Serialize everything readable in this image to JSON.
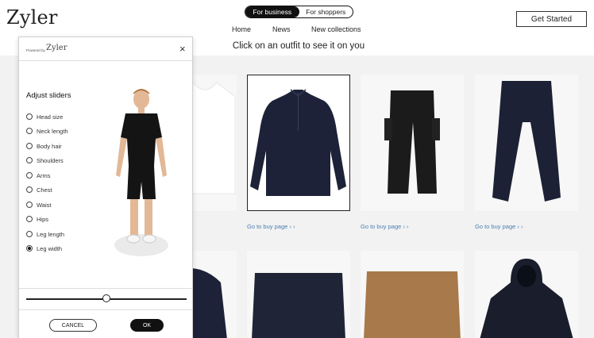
{
  "brand": {
    "logo": "Zyler"
  },
  "header": {
    "toggle": [
      {
        "label": "For business",
        "active": true
      },
      {
        "label": "For shoppers",
        "active": false
      }
    ],
    "get_started_label": "Get Started",
    "nav": [
      "Home",
      "News",
      "New collections"
    ],
    "instruction": "Click on an outfit to see it on you"
  },
  "products": {
    "buy_link": "Go to buy page › ›",
    "items": [
      {
        "name": "white-tshirt",
        "color": "#f4f4f4"
      },
      {
        "name": "navy-quarter-zip-sweater",
        "color": "#1d2238",
        "selected": true
      },
      {
        "name": "black-cargo-pants",
        "color": "#1b1b1b"
      },
      {
        "name": "navy-joggers",
        "color": "#1c2135"
      },
      {
        "name": "navy-jacket",
        "color": "#1d2238"
      },
      {
        "name": "navy-shorts",
        "color": "#1f2536"
      },
      {
        "name": "tan-shorts",
        "color": "#a8794a"
      },
      {
        "name": "navy-hoodie",
        "color": "#1a1d2c"
      }
    ]
  },
  "modal": {
    "powered_by": "Powered by",
    "logo": "Zyler",
    "title": "Adjust sliders",
    "options": [
      {
        "label": "Head size",
        "checked": false
      },
      {
        "label": "Neck length",
        "checked": false
      },
      {
        "label": "Body hair",
        "checked": false
      },
      {
        "label": "Shoulders",
        "checked": false
      },
      {
        "label": "Arms",
        "checked": false
      },
      {
        "label": "Chest",
        "checked": false
      },
      {
        "label": "Waist",
        "checked": false
      },
      {
        "label": "Hips",
        "checked": false
      },
      {
        "label": "Leg length",
        "checked": false
      },
      {
        "label": "Leg width",
        "checked": true
      }
    ],
    "slider_value": 0.5,
    "cancel_label": "CANCEL",
    "ok_label": "OK"
  },
  "colors": {
    "accent": "#111111",
    "link": "#4a7fb4"
  }
}
